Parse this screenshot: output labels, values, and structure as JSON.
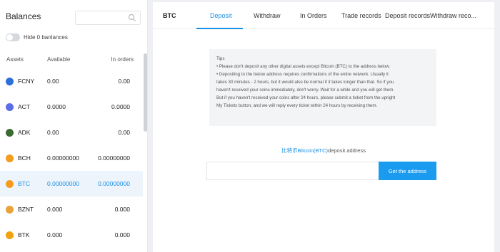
{
  "balances": {
    "title": "Balances",
    "search_placeholder": "",
    "hide_zero_label": "Hide 0 banlances",
    "columns": {
      "assets": "Assets",
      "available": "Available",
      "in_orders": "In orders"
    },
    "rows": [
      {
        "symbol": "FCNY",
        "available": "0.00",
        "in_orders": "0.00",
        "icon": "fcny-coin-icon",
        "color": "#2c6fd6",
        "active": false
      },
      {
        "symbol": "ACT",
        "available": "0.0000",
        "in_orders": "0.0000",
        "icon": "act-coin-icon",
        "color": "#5b6ee8",
        "active": false
      },
      {
        "symbol": "ADK",
        "available": "0.00",
        "in_orders": "0.00",
        "icon": "adk-coin-icon",
        "color": "#3a6b2f",
        "active": false
      },
      {
        "symbol": "BCH",
        "available": "0.00000000",
        "in_orders": "0.00000000",
        "icon": "bch-coin-icon",
        "color": "#f39c1f",
        "active": false
      },
      {
        "symbol": "BTC",
        "available": "0.00000000",
        "in_orders": "0.00000000",
        "icon": "btc-coin-icon",
        "color": "#f39c1f",
        "active": true
      },
      {
        "symbol": "BZNT",
        "available": "0.000",
        "in_orders": "0.000",
        "icon": "bznt-coin-icon",
        "color": "#e8a33a",
        "active": false
      },
      {
        "symbol": "BTK",
        "available": "0.000",
        "in_orders": "0.000",
        "icon": "btk-coin-icon",
        "color": "#f2a20c",
        "active": false
      }
    ]
  },
  "tabs": {
    "coin": "BTC",
    "items": [
      "Deposit",
      "Withdraw",
      "In Orders",
      "Trade records",
      "Deposit records",
      "Withdraw reco..."
    ],
    "active_index": 0
  },
  "tips": {
    "title": "Tips",
    "lines": [
      "• Please don't deposit any other digital assets except Bitcoin (BTC) to the address below.",
      "• Depositing to the below address requires confirmations of the entire network. Usually it",
      "takes 30 minutes - 2 hours, but it would also be normal if it takes longer than that. So if you",
      "haven't received your coins immediately, don't worry. Wait for a while and you will get them.",
      "But if you haven't received your coins after 24 hours, please submit a ticket from the upright",
      "My Tickets button, and we will reply every ticket within 24 hours by receiving them."
    ]
  },
  "deposit": {
    "coin_label": "比特币Bitcoin(BTC)",
    "address_label_suffix": "deposit address",
    "address_value": "",
    "get_address_button": "Get the address"
  },
  "colors": {
    "accent": "#1a8fe3",
    "button": "#1a9bf0"
  }
}
